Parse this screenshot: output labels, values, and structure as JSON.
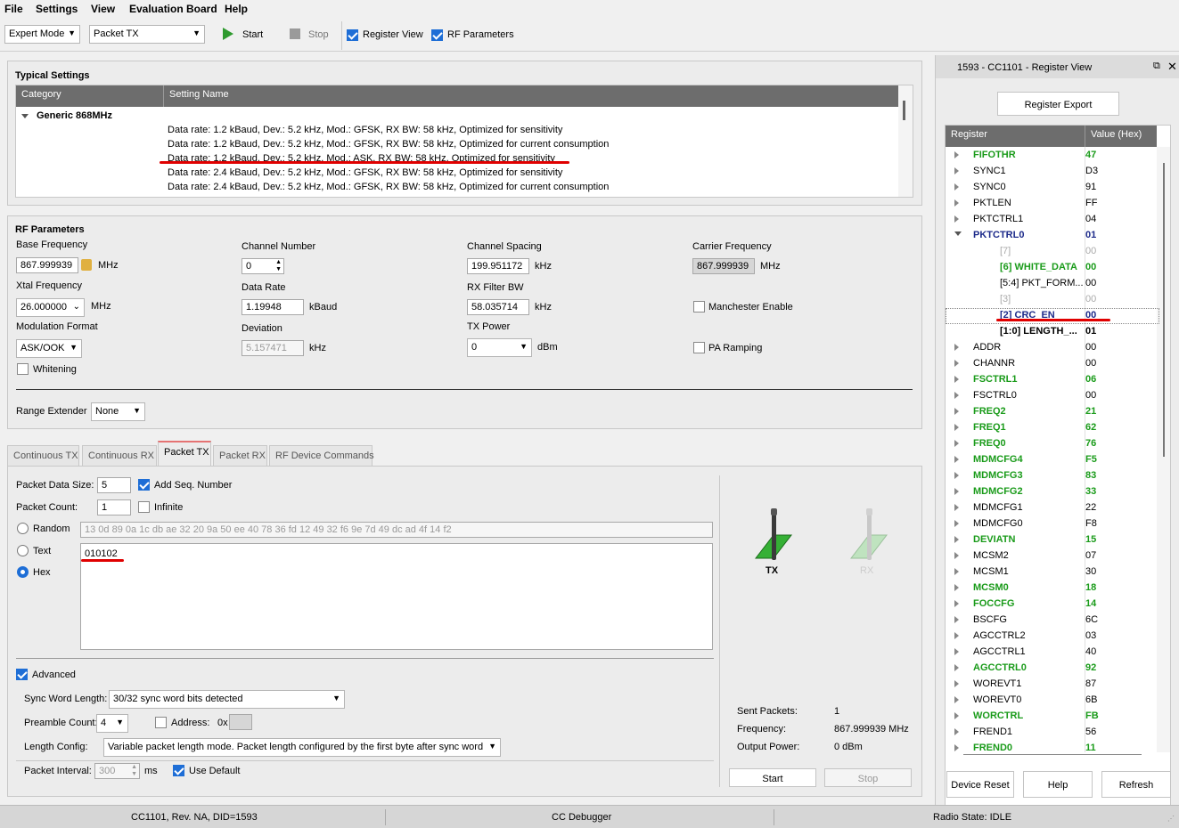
{
  "menu": [
    "File",
    "Settings",
    "View",
    "Evaluation Board",
    "Help"
  ],
  "toolbar": {
    "mode": "Expert Mode",
    "test": "Packet TX",
    "start": "Start",
    "stop": "Stop",
    "register_view": "Register View",
    "rf_parameters": "RF Parameters"
  },
  "typical": {
    "title": "Typical Settings",
    "col_category": "Category",
    "col_setting": "Setting Name",
    "group": "Generic 868MHz",
    "rows": [
      "Data rate: 1.2 kBaud,  Dev.: 5.2 kHz,  Mod.: GFSK, RX BW: 58 kHz,  Optimized for sensitivity",
      "Data rate: 1.2 kBaud,  Dev.: 5.2 kHz,  Mod.: GFSK, RX BW: 58 kHz,  Optimized for current consumption",
      "Data rate: 1.2 kBaud,  Dev.: 5.2 kHz,  Mod.: ASK,  RX BW: 58 kHz,  Optimized for sensitivity",
      "Data rate: 2.4 kBaud,  Dev.: 5.2 kHz,  Mod.: GFSK, RX BW: 58 kHz,  Optimized for sensitivity",
      "Data rate: 2.4 kBaud,  Dev.: 5.2 kHz,  Mod.: GFSK, RX BW: 58 kHz,  Optimized for current consumption"
    ]
  },
  "rf": {
    "title": "RF Parameters",
    "base_freq_label": "Base Frequency",
    "base_freq": "867.999939",
    "mhz": "MHz",
    "xtal_label": "Xtal Frequency",
    "xtal": "26.000000",
    "mod_label": "Modulation Format",
    "mod": "ASK/OOK",
    "whitening": "Whitening",
    "channel_label": "Channel Number",
    "channel": "0",
    "datarate_label": "Data Rate",
    "datarate": "1.19948",
    "kbaud": "kBaud",
    "deviation_label": "Deviation",
    "deviation": "5.157471",
    "khz": "kHz",
    "spacing_label": "Channel Spacing",
    "spacing": "199.951172",
    "rxbw_label": "RX Filter BW",
    "rxbw": "58.035714",
    "txpower_label": "TX Power",
    "txpower": "0",
    "dbm": "dBm",
    "carrier_label": "Carrier Frequency",
    "carrier": "867.999939",
    "manchester": "Manchester Enable",
    "pa_ramping": "PA Ramping",
    "range_label": "Range Extender",
    "range": "None"
  },
  "tabs": [
    "Continuous TX",
    "Continuous RX",
    "Packet TX",
    "Packet RX",
    "RF Device Commands"
  ],
  "packet": {
    "size_label": "Packet Data Size:",
    "size": "5",
    "add_seq": "Add Seq. Number",
    "count_label": "Packet Count:",
    "count": "1",
    "infinite": "Infinite",
    "random": "Random",
    "random_data": "13 0d 89 0a 1c db ae 32 20 9a 50 ee 40 78 36 fd 12 49 32 f6 9e 7d 49 dc ad 4f 14 f2",
    "text": "Text",
    "hex": "Hex",
    "hex_data": "010102",
    "advanced": "Advanced",
    "sync_label": "Sync Word Length:",
    "sync": "30/32 sync word bits detected",
    "preamble_label": "Preamble Count:",
    "preamble": "4",
    "address": "Address:",
    "addr_prefix": "0x",
    "length_label": "Length Config:",
    "length": "Variable packet length mode. Packet length configured by the first byte after sync word",
    "interval_label": "Packet Interval:",
    "interval": "300",
    "ms": "ms",
    "use_default": "Use Default"
  },
  "txrx": {
    "tx": "TX",
    "rx": "RX",
    "sent_label": "Sent Packets:",
    "sent": "1",
    "freq_label": "Frequency:",
    "freq": "867.999939 MHz",
    "power_label": "Output Power:",
    "power": "0 dBm",
    "start": "Start",
    "stop": "Stop"
  },
  "regview": {
    "title": "1593 - CC1101 - Register View",
    "export": "Register Export",
    "col_register": "Register",
    "col_value": "Value (Hex)",
    "rows": [
      {
        "name": "FIFOTHR",
        "value": "47",
        "style": "green",
        "tw": "r"
      },
      {
        "name": "SYNC1",
        "value": "D3",
        "style": "",
        "tw": "r"
      },
      {
        "name": "SYNC0",
        "value": "91",
        "style": "",
        "tw": "r"
      },
      {
        "name": "PKTLEN",
        "value": "FF",
        "style": "",
        "tw": "r"
      },
      {
        "name": "PKTCTRL1",
        "value": "04",
        "style": "",
        "tw": "r"
      },
      {
        "name": "PKTCTRL0",
        "value": "01",
        "style": "navy",
        "tw": "d"
      },
      {
        "name": "[7]",
        "value": "00",
        "style": "dim",
        "tw": "",
        "indent": true
      },
      {
        "name": "[6] WHITE_DATA",
        "value": "00",
        "style": "green",
        "tw": "",
        "indent": true
      },
      {
        "name": "[5:4] PKT_FORM...",
        "value": "00",
        "style": "",
        "tw": "",
        "indent": true
      },
      {
        "name": "[3]",
        "value": "00",
        "style": "dim",
        "tw": "",
        "indent": true
      },
      {
        "name": "[2] CRC_EN",
        "value": "00",
        "style": "navy",
        "tw": "",
        "indent": true
      },
      {
        "name": "[1:0] LENGTH_...",
        "value": "01",
        "style": "bold",
        "tw": "",
        "indent": true
      },
      {
        "name": "ADDR",
        "value": "00",
        "style": "",
        "tw": "r"
      },
      {
        "name": "CHANNR",
        "value": "00",
        "style": "",
        "tw": "r"
      },
      {
        "name": "FSCTRL1",
        "value": "06",
        "style": "green",
        "tw": "r"
      },
      {
        "name": "FSCTRL0",
        "value": "00",
        "style": "",
        "tw": "r"
      },
      {
        "name": "FREQ2",
        "value": "21",
        "style": "green",
        "tw": "r"
      },
      {
        "name": "FREQ1",
        "value": "62",
        "style": "green",
        "tw": "r"
      },
      {
        "name": "FREQ0",
        "value": "76",
        "style": "green",
        "tw": "r"
      },
      {
        "name": "MDMCFG4",
        "value": "F5",
        "style": "green",
        "tw": "r"
      },
      {
        "name": "MDMCFG3",
        "value": "83",
        "style": "green",
        "tw": "r"
      },
      {
        "name": "MDMCFG2",
        "value": "33",
        "style": "green",
        "tw": "r"
      },
      {
        "name": "MDMCFG1",
        "value": "22",
        "style": "",
        "tw": "r"
      },
      {
        "name": "MDMCFG0",
        "value": "F8",
        "style": "",
        "tw": "r"
      },
      {
        "name": "DEVIATN",
        "value": "15",
        "style": "green",
        "tw": "r"
      },
      {
        "name": "MCSM2",
        "value": "07",
        "style": "",
        "tw": "r"
      },
      {
        "name": "MCSM1",
        "value": "30",
        "style": "",
        "tw": "r"
      },
      {
        "name": "MCSM0",
        "value": "18",
        "style": "green",
        "tw": "r"
      },
      {
        "name": "FOCCFG",
        "value": "14",
        "style": "green",
        "tw": "r"
      },
      {
        "name": "BSCFG",
        "value": "6C",
        "style": "",
        "tw": "r"
      },
      {
        "name": "AGCCTRL2",
        "value": "03",
        "style": "",
        "tw": "r"
      },
      {
        "name": "AGCCTRL1",
        "value": "40",
        "style": "",
        "tw": "r"
      },
      {
        "name": "AGCCTRL0",
        "value": "92",
        "style": "green",
        "tw": "r"
      },
      {
        "name": "WOREVT1",
        "value": "87",
        "style": "",
        "tw": "r"
      },
      {
        "name": "WOREVT0",
        "value": "6B",
        "style": "",
        "tw": "r"
      },
      {
        "name": "WORCTRL",
        "value": "FB",
        "style": "green",
        "tw": "r"
      },
      {
        "name": "FREND1",
        "value": "56",
        "style": "",
        "tw": "r"
      },
      {
        "name": "FREND0",
        "value": "11",
        "style": "green",
        "tw": "r"
      }
    ],
    "device_reset": "Device Reset",
    "help": "Help",
    "refresh": "Refresh"
  },
  "status": {
    "device": "CC1101, Rev. NA, DID=1593",
    "debugger": "CC Debugger",
    "radio": "Radio State: IDLE"
  }
}
